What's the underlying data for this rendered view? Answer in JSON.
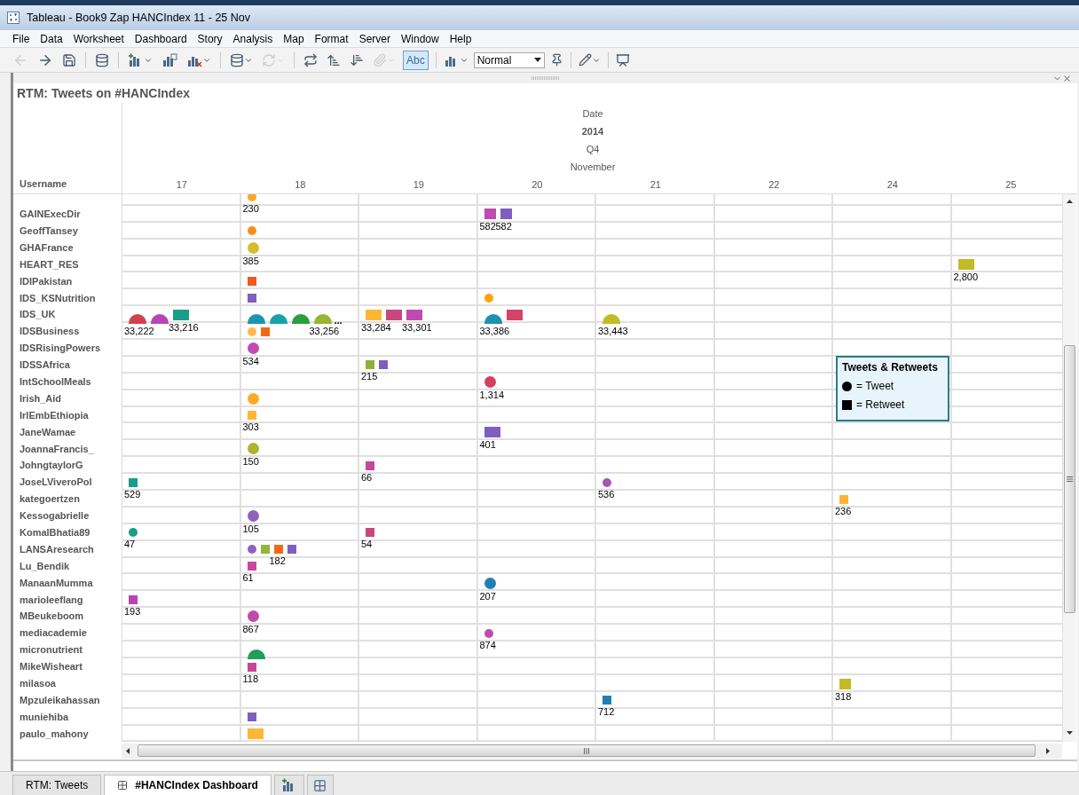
{
  "window": {
    "title": "Tableau - Book9 Zap HANCIndex 11 - 25 Nov"
  },
  "menu": [
    "File",
    "Data",
    "Worksheet",
    "Dashboard",
    "Story",
    "Analysis",
    "Map",
    "Format",
    "Server",
    "Window",
    "Help"
  ],
  "toolbar": [
    {
      "disabled": true
    },
    {
      "disabled": false
    },
    {
      "disabled": false
    },
    {
      "disabled": false
    },
    {
      "disabled": false
    },
    {
      "disabled": false
    },
    {
      "disabled": false
    },
    {
      "disabled": false
    },
    {
      "disabled": true
    },
    {
      "disabled": false
    },
    {
      "disabled": false
    },
    {
      "disabled": false
    },
    {
      "disabled": true
    }
  ],
  "labels_button": {
    "label": "Abc",
    "selected": true
  },
  "fit_select": {
    "value": "Normal"
  },
  "sheet": {
    "title": "RTM: Tweets on #HANCIndex",
    "column_header": {
      "levels": [
        {
          "text": "Date",
          "bold": false
        },
        {
          "text": "2014",
          "bold": true
        },
        {
          "text": "Q4",
          "bold": false
        },
        {
          "text": "November",
          "bold": false
        }
      ],
      "row_field": "Username",
      "columns": [
        "17",
        "18",
        "19",
        "20",
        "21",
        "22",
        "24",
        "25"
      ]
    },
    "rows": [
      {
        "cells": [
          "",
          {
            "marks": [
              {
                "kind": "dot",
                "color": "#ffa726",
                "label": "230"
              }
            ]
          },
          "",
          "",
          "",
          "",
          "",
          ""
        ]
      },
      {
        "username": "GAINExecDir",
        "cells": [
          "",
          "",
          "",
          {
            "marks": [
              {
                "kind": "tile",
                "color": "#c04aaf",
                "label": "582"
              },
              {
                "kind": "tile",
                "color": "#7e5fbd",
                "label": "582"
              }
            ]
          },
          "",
          "",
          "",
          ""
        ]
      },
      {
        "username": "GeoffTansey",
        "cells": [
          "",
          {
            "marks": [
              {
                "kind": "dot",
                "color": "#ff8c1a"
              }
            ]
          },
          "",
          "",
          "",
          "",
          "",
          ""
        ]
      },
      {
        "username": "GHAFrance",
        "cells": [
          "",
          {
            "marks": [
              {
                "kind": "circle",
                "color": "#d6bd2e",
                "label": "385"
              }
            ]
          },
          "",
          "",
          "",
          "",
          "",
          ""
        ]
      },
      {
        "username": "HEART_RES",
        "cells": [
          "",
          "",
          "",
          "",
          "",
          "",
          "",
          {
            "marks": [
              {
                "kind": "block",
                "color": "#c2bb25",
                "label": "2,800"
              }
            ]
          }
        ]
      },
      {
        "username": "IDIPakistan",
        "cells": [
          "",
          {
            "marks": [
              {
                "kind": "square",
                "color": "#ec5a22"
              }
            ]
          },
          "",
          "",
          "",
          "",
          "",
          ""
        ]
      },
      {
        "username": "IDS_KSNutrition",
        "cells": [
          "",
          {
            "marks": [
              {
                "kind": "square",
                "color": "#7e5fbd"
              }
            ]
          },
          "",
          {
            "marks": [
              {
                "kind": "dot",
                "color": "#ffa20f"
              }
            ]
          },
          "",
          "",
          "",
          ""
        ]
      },
      {
        "username": "IDS_UK",
        "cells": [
          {
            "marks": [
              {
                "kind": "dome",
                "color": "#d3414f",
                "label": "33,222"
              },
              {
                "kind": "dome",
                "color": "#b845b4"
              },
              {
                "kind": "block",
                "color": "#1a9e8a",
                "label": "33,216"
              }
            ]
          },
          {
            "more": "...",
            "marks": [
              {
                "kind": "dome",
                "color": "#1f93b3"
              },
              {
                "kind": "dome",
                "color": "#17a2aa"
              },
              {
                "kind": "dome",
                "color": "#2a9d3e"
              },
              {
                "kind": "dome",
                "color": "#98b533",
                "label": "33,256"
              }
            ]
          },
          {
            "marks": [
              {
                "kind": "block",
                "color": "#ffb634",
                "label": "33,284"
              },
              {
                "kind": "block",
                "color": "#c8477f"
              },
              {
                "kind": "block",
                "color": "#c04aaf",
                "label": "33,301"
              }
            ]
          },
          {
            "marks": [
              {
                "kind": "dome",
                "color": "#1f8fb5",
                "label": "33,386"
              },
              {
                "kind": "block",
                "color": "#d3446a"
              }
            ]
          },
          {
            "marks": [
              {
                "kind": "dome",
                "color": "#c2bb25",
                "label": "33,443"
              }
            ]
          },
          "",
          "",
          ""
        ]
      },
      {
        "username": "IDSBusiness",
        "cells": [
          "",
          {
            "marks": [
              {
                "kind": "dot",
                "color": "#ffb84a"
              },
              {
                "kind": "square",
                "color": "#f36818"
              }
            ]
          },
          "",
          "",
          "",
          "",
          "",
          ""
        ]
      },
      {
        "username": "IDSRisingPowers",
        "cells": [
          "",
          {
            "marks": [
              {
                "kind": "circle",
                "color": "#c04aaf",
                "label": "534"
              }
            ]
          },
          "",
          "",
          "",
          "",
          "",
          ""
        ]
      },
      {
        "username": "IDSSAfrica",
        "cells": [
          "",
          "",
          {
            "marks": [
              {
                "kind": "square",
                "color": "#8fb03a",
                "label": "215"
              },
              {
                "kind": "square",
                "color": "#7e5fbd"
              }
            ]
          },
          "",
          "",
          "",
          "",
          ""
        ]
      },
      {
        "username": "IntSchoolMeals",
        "cells": [
          "",
          "",
          "",
          {
            "marks": [
              {
                "kind": "circle",
                "color": "#d3415f",
                "label": "1,314"
              }
            ]
          },
          "",
          "",
          "",
          ""
        ]
      },
      {
        "username": "Irish_Aid",
        "cells": [
          "",
          {
            "marks": [
              {
                "kind": "circle",
                "color": "#ffaa26"
              }
            ]
          },
          "",
          "",
          "",
          "",
          "",
          ""
        ]
      },
      {
        "username": "IrlEmbEthiopia",
        "cells": [
          "",
          {
            "marks": [
              {
                "kind": "square",
                "color": "#ffb634",
                "label": "303"
              }
            ]
          },
          "",
          "",
          "",
          "",
          "",
          ""
        ]
      },
      {
        "username": "JaneWamae",
        "cells": [
          "",
          "",
          "",
          {
            "marks": [
              {
                "kind": "block",
                "color": "#7e5fbd",
                "label": "401"
              }
            ]
          },
          "",
          "",
          "",
          ""
        ]
      },
      {
        "username": "JoannaFrancis_",
        "cells": [
          "",
          {
            "marks": [
              {
                "kind": "circle",
                "color": "#a8b72c",
                "label": "150"
              }
            ]
          },
          "",
          "",
          "",
          "",
          "",
          ""
        ]
      },
      {
        "username": "JohngtaylorG",
        "cells": [
          "",
          "",
          {
            "marks": [
              {
                "kind": "square",
                "color": "#c8479a",
                "label": "66"
              }
            ]
          },
          "",
          "",
          "",
          "",
          ""
        ]
      },
      {
        "username": "JoseLViveroPol",
        "cells": [
          {
            "marks": [
              {
                "kind": "square",
                "color": "#1a9e8a",
                "label": "529"
              }
            ]
          },
          "",
          "",
          "",
          {
            "marks": [
              {
                "kind": "dot",
                "color": "#a855b8",
                "label": "536"
              }
            ]
          },
          "",
          "",
          ""
        ]
      },
      {
        "username": "kategoertzen",
        "cells": [
          "",
          "",
          "",
          "",
          "",
          "",
          {
            "marks": [
              {
                "kind": "square",
                "color": "#ffb634",
                "label": "236"
              }
            ]
          },
          ""
        ]
      },
      {
        "username": "Kessogabrielle",
        "cells": [
          "",
          {
            "marks": [
              {
                "kind": "circle",
                "color": "#8e62bd",
                "label": "105"
              }
            ]
          },
          "",
          "",
          "",
          "",
          "",
          ""
        ]
      },
      {
        "username": "KomalBhatia89",
        "cells": [
          {
            "marks": [
              {
                "kind": "dot",
                "color": "#1a9e8a",
                "label": "47"
              }
            ]
          },
          "",
          {
            "marks": [
              {
                "kind": "square",
                "color": "#c8477f",
                "label": "54"
              }
            ]
          },
          "",
          "",
          "",
          "",
          ""
        ]
      },
      {
        "username": "LANSAresearch",
        "cells": [
          "",
          {
            "marks": [
              {
                "kind": "dot",
                "color": "#8e62bd"
              },
              {
                "kind": "square",
                "color": "#95b33a"
              },
              {
                "kind": "square",
                "color": "#f36818",
                "label": "182"
              },
              {
                "kind": "square",
                "color": "#7e5fbd"
              }
            ]
          },
          "",
          "",
          "",
          "",
          "",
          ""
        ]
      },
      {
        "username": "Lu_Bendik",
        "cells": [
          "",
          {
            "marks": [
              {
                "kind": "square",
                "color": "#c8479a",
                "label": "61"
              }
            ]
          },
          "",
          "",
          "",
          "",
          "",
          ""
        ]
      },
      {
        "username": "ManaanMumma",
        "cells": [
          "",
          "",
          "",
          {
            "marks": [
              {
                "kind": "circle",
                "color": "#1f7fb5",
                "label": "207"
              }
            ]
          },
          "",
          "",
          "",
          ""
        ]
      },
      {
        "username": "marioleeflang",
        "cells": [
          {
            "marks": [
              {
                "kind": "square",
                "color": "#b845b4",
                "label": "193"
              }
            ]
          },
          "",
          "",
          "",
          "",
          "",
          "",
          ""
        ]
      },
      {
        "username": "MBeukeboom",
        "cells": [
          "",
          {
            "marks": [
              {
                "kind": "circle",
                "color": "#c04aaf",
                "label": "867"
              }
            ]
          },
          "",
          "",
          "",
          "",
          "",
          ""
        ]
      },
      {
        "username": "mediacademie",
        "cells": [
          "",
          "",
          "",
          {
            "marks": [
              {
                "kind": "dot",
                "color": "#c04aaf",
                "label": "874"
              }
            ]
          },
          "",
          "",
          "",
          ""
        ]
      },
      {
        "username": "micronutrient",
        "cells": [
          "",
          {
            "marks": [
              {
                "kind": "dome",
                "color": "#239e5a"
              }
            ]
          },
          "",
          "",
          "",
          "",
          "",
          ""
        ]
      },
      {
        "username": "MikeWisheart",
        "cells": [
          "",
          {
            "marks": [
              {
                "kind": "square",
                "color": "#c8479a",
                "label": "118"
              }
            ]
          },
          "",
          "",
          "",
          "",
          "",
          ""
        ]
      },
      {
        "username": "milasoa",
        "cells": [
          "",
          "",
          "",
          "",
          "",
          "",
          {
            "marks": [
              {
                "kind": "tile",
                "color": "#c2bb25",
                "label": "318"
              }
            ]
          },
          ""
        ]
      },
      {
        "username": "Mpzuleikahassan",
        "cells": [
          "",
          "",
          "",
          "",
          {
            "marks": [
              {
                "kind": "square",
                "color": "#1f7fb5",
                "label": "712"
              }
            ]
          },
          "",
          "",
          ""
        ]
      },
      {
        "username": "muniehiba",
        "cells": [
          "",
          {
            "marks": [
              {
                "kind": "square",
                "color": "#7e5fbd"
              }
            ]
          },
          "",
          "",
          "",
          "",
          "",
          ""
        ]
      },
      {
        "username": "paulo_mahony",
        "cells": [
          "",
          {
            "marks": [
              {
                "kind": "block",
                "color": "#ffb634"
              }
            ]
          },
          "",
          "",
          "",
          "",
          "",
          ""
        ]
      }
    ],
    "legend": {
      "title": "Tweets & Retweets",
      "items": [
        {
          "kind": "tweet",
          "text": "= Tweet"
        },
        {
          "kind": "retweet",
          "text": "= Retweet"
        }
      ]
    }
  },
  "tabs": [
    {
      "kind": "sheet",
      "label": "RTM: Tweets",
      "selected": false
    },
    {
      "kind": "dashboard",
      "label": "#HANCIndex Dashboard",
      "selected": true
    },
    {
      "kind": "new-worksheet"
    },
    {
      "kind": "new-dashboard"
    }
  ]
}
